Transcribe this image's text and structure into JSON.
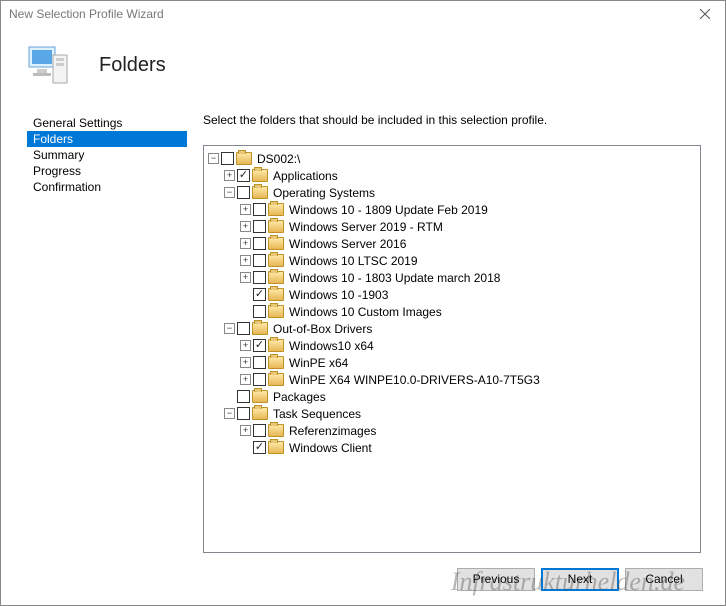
{
  "window": {
    "title": "New Selection Profile Wizard"
  },
  "header": {
    "title": "Folders"
  },
  "nav": {
    "items": [
      {
        "label": "General Settings",
        "selected": false
      },
      {
        "label": "Folders",
        "selected": true
      },
      {
        "label": "Summary",
        "selected": false
      },
      {
        "label": "Progress",
        "selected": false
      },
      {
        "label": "Confirmation",
        "selected": false
      }
    ]
  },
  "instruction": "Select the folders that should be included in this selection profile.",
  "tree": [
    {
      "label": "DS002:\\",
      "expand": "-",
      "checked": false,
      "children": [
        {
          "label": "Applications",
          "expand": "+",
          "checked": true
        },
        {
          "label": "Operating Systems",
          "expand": "-",
          "checked": false,
          "children": [
            {
              "label": "Windows 10 - 1809 Update Feb 2019",
              "expand": "+",
              "checked": false
            },
            {
              "label": "Windows Server 2019 - RTM",
              "expand": "+",
              "checked": false
            },
            {
              "label": "Windows Server 2016",
              "expand": "+",
              "checked": false
            },
            {
              "label": "Windows 10 LTSC 2019",
              "expand": "+",
              "checked": false
            },
            {
              "label": "Windows 10 - 1803 Update march 2018",
              "expand": "+",
              "checked": false
            },
            {
              "label": "Windows 10 -1903",
              "expand": null,
              "checked": true
            },
            {
              "label": "Windows 10 Custom Images",
              "expand": null,
              "checked": false
            }
          ]
        },
        {
          "label": "Out-of-Box Drivers",
          "expand": "-",
          "checked": false,
          "children": [
            {
              "label": "Windows10 x64",
              "expand": "+",
              "checked": true
            },
            {
              "label": "WinPE x64",
              "expand": "+",
              "checked": false
            },
            {
              "label": "WinPE X64 WINPE10.0-DRIVERS-A10-7T5G3",
              "expand": "+",
              "checked": false
            }
          ]
        },
        {
          "label": "Packages",
          "expand": null,
          "checked": false
        },
        {
          "label": "Task Sequences",
          "expand": "-",
          "checked": false,
          "children": [
            {
              "label": "Referenzimages",
              "expand": "+",
              "checked": false
            },
            {
              "label": "Windows Client",
              "expand": null,
              "checked": true
            }
          ]
        }
      ]
    }
  ],
  "buttons": {
    "previous": "Previous",
    "next": "Next",
    "cancel": "Cancel"
  },
  "watermark": "Infrastrukturhelden.de"
}
